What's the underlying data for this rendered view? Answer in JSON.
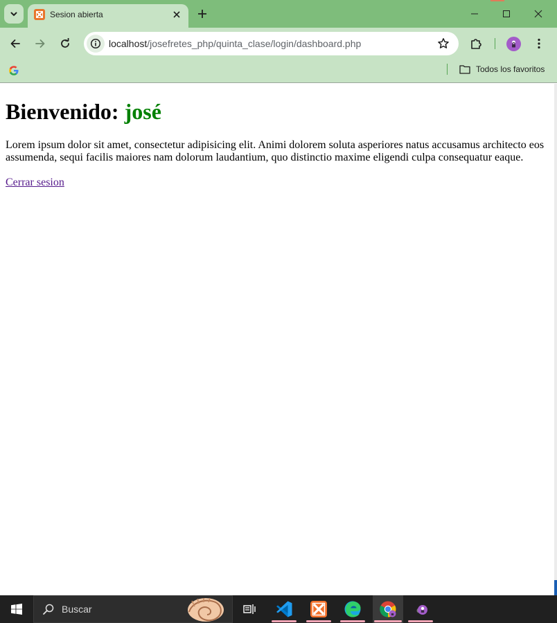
{
  "browser": {
    "tab": {
      "title": "Sesion abierta",
      "favicon": "xampp-icon"
    },
    "url": {
      "host": "localhost",
      "path": "/josefretes_php/quinta_clase/login/dashboard.php"
    },
    "bookmarks": {
      "all_label": "Todos los favoritos"
    },
    "theme_colors": {
      "frame": "#7ebd7b",
      "toolbar": "#c7e3c5"
    }
  },
  "page": {
    "welcome_prefix": "Bienvenido: ",
    "username": "josé",
    "username_color": "#008000",
    "paragraph": "Lorem ipsum dolor sit amet, consectetur adipisicing elit. Animi dolorem soluta asperiores natus accusamus architecto eos assumenda, sequi facilis maiores nam dolorum laudantium, quo distinctio maxime eligendi culpa consequatur eaque.",
    "logout_label": "Cerrar sesion"
  },
  "taskbar": {
    "search_placeholder": "Buscar",
    "items": [
      "task-view-icon",
      "vscode-icon",
      "xampp-icon",
      "edge-icon",
      "chrome-icon",
      "chrome-profile-icon"
    ]
  }
}
